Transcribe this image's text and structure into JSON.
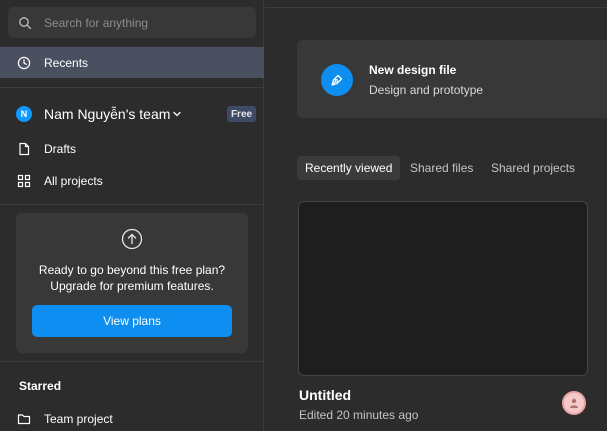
{
  "search": {
    "placeholder": "Search for anything"
  },
  "nav": {
    "recents": "Recents"
  },
  "team": {
    "initial": "N",
    "name": "Nam Nguyễn's team",
    "badge": "Free",
    "items": [
      {
        "label": "Drafts",
        "icon": "file-icon"
      },
      {
        "label": "All projects",
        "icon": "grid-icon"
      }
    ]
  },
  "upsell": {
    "line1": "Ready to go beyond this free plan?",
    "line2": "Upgrade for premium features.",
    "button": "View plans"
  },
  "starred": {
    "title": "Starred",
    "items": [
      {
        "label": "Team project",
        "icon": "folder-icon"
      }
    ]
  },
  "new_file": {
    "title": "New design file",
    "subtitle": "Design and prototype"
  },
  "tabs": [
    "Recently viewed",
    "Shared files",
    "Shared projects"
  ],
  "active_tab": "Recently viewed",
  "recent_file": {
    "title": "Untitled",
    "meta": "Edited 20 minutes ago"
  },
  "colors": {
    "accent": "#0d8ef0",
    "background": "#2c2c2c",
    "panel": "#383838",
    "badge": "#3e4a66"
  }
}
